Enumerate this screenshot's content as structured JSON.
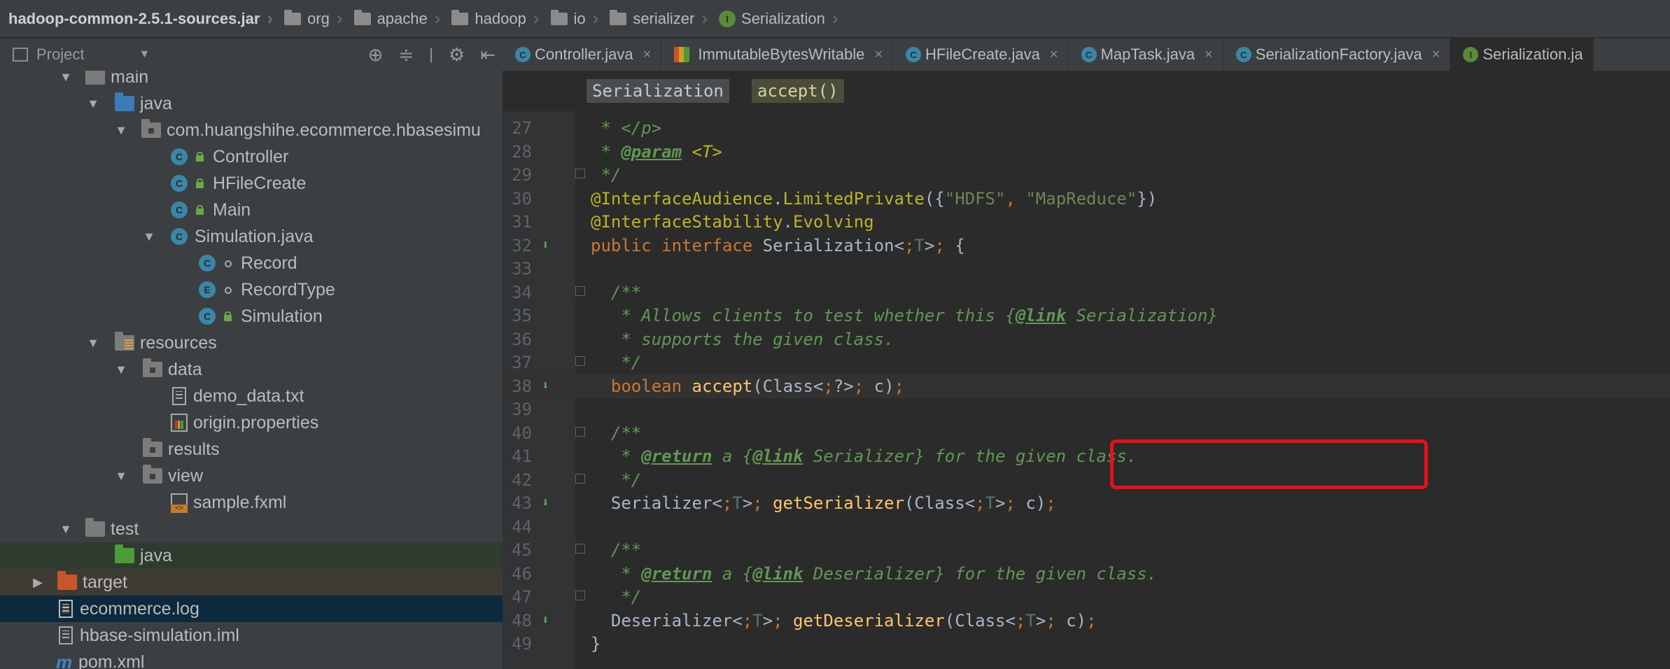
{
  "breadcrumb": {
    "items": [
      "hadoop-common-2.5.1-sources.jar",
      "org",
      "apache",
      "hadoop",
      "io",
      "serializer",
      "Serialization"
    ]
  },
  "project_panel": {
    "title": "Project",
    "tree": [
      {
        "label": "main",
        "kind": "folder-gray"
      },
      {
        "label": "java",
        "kind": "folder-blue"
      },
      {
        "label": "com.huangshihe.ecommerce.hbasesimu",
        "kind": "package"
      },
      {
        "label": "Controller",
        "kind": "class"
      },
      {
        "label": "HFileCreate",
        "kind": "class"
      },
      {
        "label": "Main",
        "kind": "class-run"
      },
      {
        "label": "Simulation.java",
        "kind": "class-file"
      },
      {
        "label": "Record",
        "kind": "class-inner"
      },
      {
        "label": "RecordType",
        "kind": "enum"
      },
      {
        "label": "Simulation",
        "kind": "class"
      },
      {
        "label": "resources",
        "kind": "folder-resources"
      },
      {
        "label": "data",
        "kind": "folder-gray"
      },
      {
        "label": "demo_data.txt",
        "kind": "text-file"
      },
      {
        "label": "origin.properties",
        "kind": "properties-file"
      },
      {
        "label": "results",
        "kind": "folder-gray"
      },
      {
        "label": "view",
        "kind": "folder-gray"
      },
      {
        "label": "sample.fxml",
        "kind": "fxml-file"
      },
      {
        "label": "test",
        "kind": "folder-gray"
      },
      {
        "label": "java",
        "kind": "folder-green"
      },
      {
        "label": "target",
        "kind": "folder-orange"
      },
      {
        "label": "ecommerce.log",
        "kind": "log-file"
      },
      {
        "label": "hbase-simulation.iml",
        "kind": "iml-file"
      },
      {
        "label": "pom.xml",
        "kind": "maven-file"
      }
    ]
  },
  "tabs": [
    {
      "label": "Controller.java",
      "icon": "class-icon"
    },
    {
      "label": "ImmutableBytesWritable",
      "icon": "jar-class-icon"
    },
    {
      "label": "HFileCreate.java",
      "icon": "class-icon"
    },
    {
      "label": "MapTask.java",
      "icon": "class-icon"
    },
    {
      "label": "SerializationFactory.java",
      "icon": "class-icon"
    },
    {
      "label": "Serialization.ja",
      "icon": "interface-icon"
    }
  ],
  "editor": {
    "crumbs": [
      "Serialization",
      "accept()"
    ],
    "lines": [
      {
        "n": "27",
        "code": " * </p>"
      },
      {
        "n": "28",
        "code": " * @param <T>"
      },
      {
        "n": "29",
        "code": " */"
      },
      {
        "n": "30",
        "code": "@InterfaceAudience.LimitedPrivate({\"HDFS\", \"MapReduce\"})"
      },
      {
        "n": "31",
        "code": "@InterfaceStability.Evolving"
      },
      {
        "n": "32",
        "code": "public interface Serialization<T> {"
      },
      {
        "n": "33",
        "code": ""
      },
      {
        "n": "34",
        "code": "  /**"
      },
      {
        "n": "35",
        "code": "   * Allows clients to test whether this {@link Serialization}"
      },
      {
        "n": "36",
        "code": "   * supports the given class."
      },
      {
        "n": "37",
        "code": "   */"
      },
      {
        "n": "38",
        "code": "  boolean accept(Class<?> c);"
      },
      {
        "n": "39",
        "code": ""
      },
      {
        "n": "40",
        "code": "  /**"
      },
      {
        "n": "41",
        "code": "   * @return a {@link Serializer} for the given class."
      },
      {
        "n": "42",
        "code": "   */"
      },
      {
        "n": "43",
        "code": "  Serializer<T> getSerializer(Class<T> c);"
      },
      {
        "n": "44",
        "code": ""
      },
      {
        "n": "45",
        "code": "  /**"
      },
      {
        "n": "46",
        "code": "   * @return a {@link Deserializer} for the given class."
      },
      {
        "n": "47",
        "code": "   */"
      },
      {
        "n": "48",
        "code": "  Deserializer<T> getDeserializer(Class<T> c);"
      },
      {
        "n": "49",
        "code": "}"
      }
    ]
  },
  "colors": {
    "keyword": "#cc7832",
    "annotation": "#bbb529",
    "string": "#6a8759",
    "comment": "#629755",
    "method": "#ffc66d",
    "highlight_box": "#e8101a"
  }
}
